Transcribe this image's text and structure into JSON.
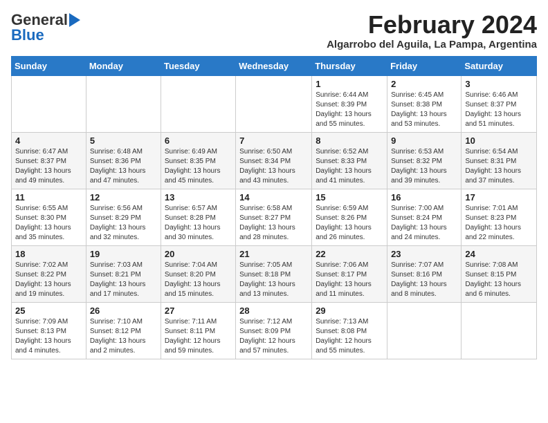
{
  "header": {
    "logo_general": "General",
    "logo_blue": "Blue",
    "month_title": "February 2024",
    "subtitle": "Algarrobo del Aguila, La Pampa, Argentina"
  },
  "weekdays": [
    "Sunday",
    "Monday",
    "Tuesday",
    "Wednesday",
    "Thursday",
    "Friday",
    "Saturday"
  ],
  "weeks": [
    [
      {
        "day": "",
        "info": ""
      },
      {
        "day": "",
        "info": ""
      },
      {
        "day": "",
        "info": ""
      },
      {
        "day": "",
        "info": ""
      },
      {
        "day": "1",
        "info": "Sunrise: 6:44 AM\nSunset: 8:39 PM\nDaylight: 13 hours and 55 minutes."
      },
      {
        "day": "2",
        "info": "Sunrise: 6:45 AM\nSunset: 8:38 PM\nDaylight: 13 hours and 53 minutes."
      },
      {
        "day": "3",
        "info": "Sunrise: 6:46 AM\nSunset: 8:37 PM\nDaylight: 13 hours and 51 minutes."
      }
    ],
    [
      {
        "day": "4",
        "info": "Sunrise: 6:47 AM\nSunset: 8:37 PM\nDaylight: 13 hours and 49 minutes."
      },
      {
        "day": "5",
        "info": "Sunrise: 6:48 AM\nSunset: 8:36 PM\nDaylight: 13 hours and 47 minutes."
      },
      {
        "day": "6",
        "info": "Sunrise: 6:49 AM\nSunset: 8:35 PM\nDaylight: 13 hours and 45 minutes."
      },
      {
        "day": "7",
        "info": "Sunrise: 6:50 AM\nSunset: 8:34 PM\nDaylight: 13 hours and 43 minutes."
      },
      {
        "day": "8",
        "info": "Sunrise: 6:52 AM\nSunset: 8:33 PM\nDaylight: 13 hours and 41 minutes."
      },
      {
        "day": "9",
        "info": "Sunrise: 6:53 AM\nSunset: 8:32 PM\nDaylight: 13 hours and 39 minutes."
      },
      {
        "day": "10",
        "info": "Sunrise: 6:54 AM\nSunset: 8:31 PM\nDaylight: 13 hours and 37 minutes."
      }
    ],
    [
      {
        "day": "11",
        "info": "Sunrise: 6:55 AM\nSunset: 8:30 PM\nDaylight: 13 hours and 35 minutes."
      },
      {
        "day": "12",
        "info": "Sunrise: 6:56 AM\nSunset: 8:29 PM\nDaylight: 13 hours and 32 minutes."
      },
      {
        "day": "13",
        "info": "Sunrise: 6:57 AM\nSunset: 8:28 PM\nDaylight: 13 hours and 30 minutes."
      },
      {
        "day": "14",
        "info": "Sunrise: 6:58 AM\nSunset: 8:27 PM\nDaylight: 13 hours and 28 minutes."
      },
      {
        "day": "15",
        "info": "Sunrise: 6:59 AM\nSunset: 8:26 PM\nDaylight: 13 hours and 26 minutes."
      },
      {
        "day": "16",
        "info": "Sunrise: 7:00 AM\nSunset: 8:24 PM\nDaylight: 13 hours and 24 minutes."
      },
      {
        "day": "17",
        "info": "Sunrise: 7:01 AM\nSunset: 8:23 PM\nDaylight: 13 hours and 22 minutes."
      }
    ],
    [
      {
        "day": "18",
        "info": "Sunrise: 7:02 AM\nSunset: 8:22 PM\nDaylight: 13 hours and 19 minutes."
      },
      {
        "day": "19",
        "info": "Sunrise: 7:03 AM\nSunset: 8:21 PM\nDaylight: 13 hours and 17 minutes."
      },
      {
        "day": "20",
        "info": "Sunrise: 7:04 AM\nSunset: 8:20 PM\nDaylight: 13 hours and 15 minutes."
      },
      {
        "day": "21",
        "info": "Sunrise: 7:05 AM\nSunset: 8:18 PM\nDaylight: 13 hours and 13 minutes."
      },
      {
        "day": "22",
        "info": "Sunrise: 7:06 AM\nSunset: 8:17 PM\nDaylight: 13 hours and 11 minutes."
      },
      {
        "day": "23",
        "info": "Sunrise: 7:07 AM\nSunset: 8:16 PM\nDaylight: 13 hours and 8 minutes."
      },
      {
        "day": "24",
        "info": "Sunrise: 7:08 AM\nSunset: 8:15 PM\nDaylight: 13 hours and 6 minutes."
      }
    ],
    [
      {
        "day": "25",
        "info": "Sunrise: 7:09 AM\nSunset: 8:13 PM\nDaylight: 13 hours and 4 minutes."
      },
      {
        "day": "26",
        "info": "Sunrise: 7:10 AM\nSunset: 8:12 PM\nDaylight: 13 hours and 2 minutes."
      },
      {
        "day": "27",
        "info": "Sunrise: 7:11 AM\nSunset: 8:11 PM\nDaylight: 12 hours and 59 minutes."
      },
      {
        "day": "28",
        "info": "Sunrise: 7:12 AM\nSunset: 8:09 PM\nDaylight: 12 hours and 57 minutes."
      },
      {
        "day": "29",
        "info": "Sunrise: 7:13 AM\nSunset: 8:08 PM\nDaylight: 12 hours and 55 minutes."
      },
      {
        "day": "",
        "info": ""
      },
      {
        "day": "",
        "info": ""
      }
    ]
  ]
}
